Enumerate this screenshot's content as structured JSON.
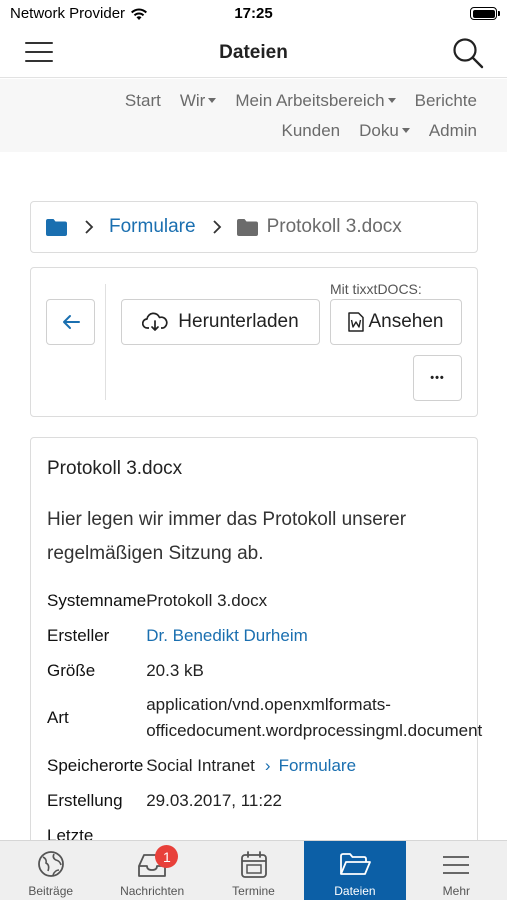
{
  "status_bar": {
    "carrier": "Network Provider",
    "time": "17:25"
  },
  "nav": {
    "title": "Dateien"
  },
  "top_menu": {
    "row1": [
      {
        "label": "Start",
        "dropdown": false
      },
      {
        "label": "Wir",
        "dropdown": true
      },
      {
        "label": "Mein Arbeitsbereich",
        "dropdown": true
      },
      {
        "label": "Berichte",
        "dropdown": false
      }
    ],
    "row2": [
      {
        "label": "Kunden",
        "dropdown": false
      },
      {
        "label": "Doku",
        "dropdown": true
      },
      {
        "label": "Admin",
        "dropdown": false
      }
    ]
  },
  "breadcrumb": {
    "parent": "Formulare",
    "current": "Protokoll 3.docx"
  },
  "toolbar": {
    "download_label": "Herunterladen",
    "tixxt_label": "Mit tixxtDOCS:",
    "view_label": "Ansehen",
    "more_label": "•••"
  },
  "details": {
    "title": "Protokoll 3.docx",
    "description": "Hier legen wir immer das Protokoll unserer regelmäßigen Sitzung ab.",
    "rows": {
      "systemname_key": "Systemname",
      "systemname_val": "Protokoll 3.docx",
      "creator_key": "Ersteller",
      "creator_val": "Dr. Benedikt Durheim",
      "size_key": "Größe",
      "size_val": "20.3 kB",
      "type_key": "Art",
      "type_val_line1": "application/vnd.openxmlformats-",
      "type_val_line2": "officedocument.wordprocessingml.document",
      "locations_key": "Speicherorte",
      "location_root": "Social Intranet",
      "location_folder": "Formulare",
      "created_key": "Erstellung",
      "created_val": "29.03.2017, 11:22",
      "last_key": "Letzte"
    }
  },
  "tab_bar": {
    "tabs": [
      {
        "label": "Beiträge"
      },
      {
        "label": "Nachrichten",
        "badge": "1"
      },
      {
        "label": "Termine"
      },
      {
        "label": "Dateien",
        "active": true
      },
      {
        "label": "Mehr"
      }
    ]
  },
  "colors": {
    "accent": "#1a6fb0",
    "active_tab": "#0c5fa6",
    "badge": "#e8403a"
  }
}
